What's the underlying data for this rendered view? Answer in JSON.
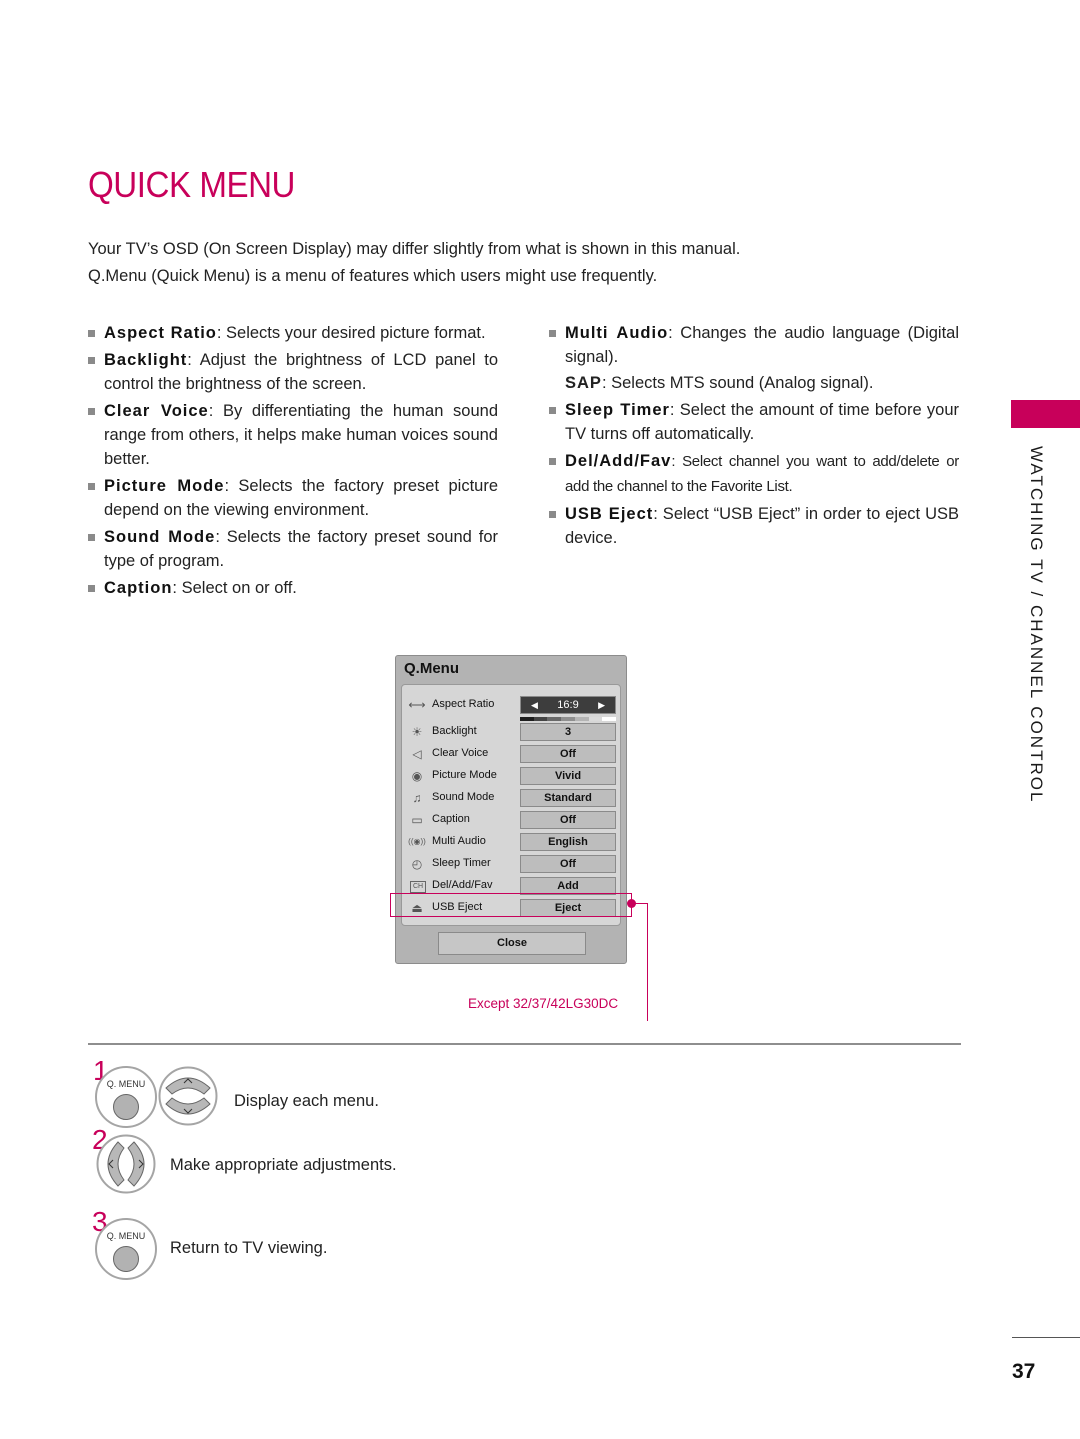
{
  "page": {
    "title": "QUICK MENU",
    "intro": [
      "Your TV’s OSD (On Screen Display) may differ slightly from what is shown in this manual.",
      "Q.Menu (Quick Menu) is a menu of features which users might use frequently."
    ],
    "section_tab": "WATCHING TV / CHANNEL CONTROL",
    "page_number": "37",
    "accent_color": "#c8005a"
  },
  "bullets_left": [
    {
      "term": "Aspect Ratio",
      "desc": ": Selects your desired picture format."
    },
    {
      "term": "Backlight",
      "desc": ": Adjust the brightness of LCD panel to control the brightness of the screen."
    },
    {
      "term": "Clear Voice",
      "desc": ": By differentiating the human sound range from others, it helps make human voices sound better."
    },
    {
      "term": "Picture Mode",
      "desc": ": Selects the factory preset picture depend on the viewing environment."
    },
    {
      "term": "Sound Mode",
      "desc": ": Selects the factory preset sound for type of program."
    },
    {
      "term": "Caption",
      "desc": ": Select on or off."
    }
  ],
  "bullets_right": [
    {
      "term": "Multi Audio",
      "desc": ": Changes the audio language (Digital signal)."
    },
    {
      "term": "SAP",
      "desc": ": Selects MTS sound (Analog signal)."
    },
    {
      "term": "Sleep Timer",
      "desc": ": Select the amount of time before your TV turns off automatically."
    },
    {
      "term": "Del/Add/Fav",
      "desc": ": Select channel you want to add/delete or add the channel to the Favorite List."
    },
    {
      "term": "USB Eject",
      "desc": ": Select “USB Eject” in order to eject USB device."
    }
  ],
  "qmenu": {
    "title": "Q.Menu",
    "items": [
      {
        "icon": "aspect-ratio-icon",
        "glyph": "⟷",
        "label": "Aspect Ratio",
        "value": "16:9",
        "arrow_left": "◀",
        "arrow_right": "▶"
      },
      {
        "icon": "backlight-icon",
        "glyph": "☀",
        "label": "Backlight",
        "value": "3",
        "level_steps": 7,
        "level": 3
      },
      {
        "icon": "clear-voice-icon",
        "glyph": "◁",
        "label": "Clear Voice",
        "value": "Off"
      },
      {
        "icon": "picture-mode-icon",
        "glyph": "◉",
        "label": "Picture Mode",
        "value": "Vivid"
      },
      {
        "icon": "sound-mode-icon",
        "glyph": "♫",
        "label": "Sound Mode",
        "value": "Standard"
      },
      {
        "icon": "caption-icon",
        "glyph": "▭",
        "label": "Caption",
        "value": "Off"
      },
      {
        "icon": "multi-audio-icon",
        "glyph": "((◉))",
        "label": "Multi Audio",
        "value": "English"
      },
      {
        "icon": "sleep-timer-icon",
        "glyph": "◴",
        "label": "Sleep Timer",
        "value": "Off"
      },
      {
        "icon": "del-add-fav-icon",
        "glyph": "CH",
        "label": "Del/Add/Fav",
        "value": "Add"
      },
      {
        "icon": "usb-eject-icon",
        "glyph": "⏏",
        "label": "USB Eject",
        "value": "Eject"
      }
    ],
    "close_label": "Close",
    "note": "Except 32/37/42LG30DC"
  },
  "steps": [
    {
      "number": "1",
      "button_label": "Q. MENU",
      "text": "Display each menu."
    },
    {
      "number": "2",
      "text": "Make appropriate adjustments."
    },
    {
      "number": "3",
      "button_label": "Q. MENU",
      "text": "Return to TV viewing."
    }
  ]
}
